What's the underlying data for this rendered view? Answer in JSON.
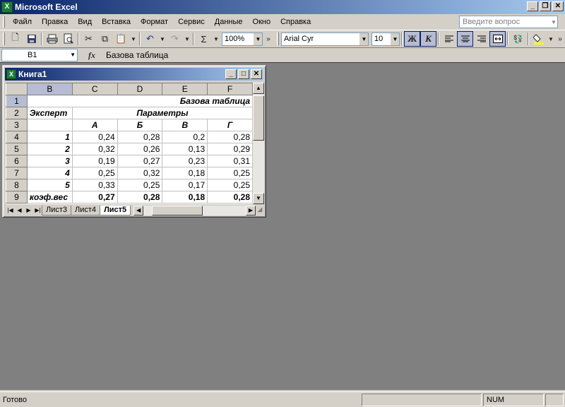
{
  "app": {
    "title": "Microsoft Excel"
  },
  "menu": {
    "items": [
      "Файл",
      "Правка",
      "Вид",
      "Вставка",
      "Формат",
      "Сервис",
      "Данные",
      "Окно",
      "Справка"
    ],
    "help_placeholder": "Введите вопрос"
  },
  "toolbar": {
    "zoom": "100%",
    "font": "Arial Cyr",
    "font_size": "10",
    "bold_label": "Ж",
    "italic_label": "К",
    "sum_label": "Σ"
  },
  "formula_bar": {
    "name_box": "B1",
    "fx_label": "fx",
    "content": "Базова таблица"
  },
  "workbook": {
    "title": "Книга1",
    "column_headers": [
      "B",
      "C",
      "D",
      "E",
      "F"
    ],
    "row_headers": [
      "1",
      "2",
      "3",
      "4",
      "5",
      "6",
      "7",
      "8",
      "9"
    ],
    "cells": {
      "title": "Базова таблица",
      "expert": "Эксперт",
      "params": "Параметры",
      "param_names": [
        "А",
        "Б",
        "В",
        "Г"
      ],
      "rows": [
        {
          "label": "1",
          "values": [
            "0,24",
            "0,28",
            "0,2",
            "0,28"
          ]
        },
        {
          "label": "2",
          "values": [
            "0,32",
            "0,26",
            "0,13",
            "0,29"
          ]
        },
        {
          "label": "3",
          "values": [
            "0,19",
            "0,27",
            "0,23",
            "0,31"
          ]
        },
        {
          "label": "4",
          "values": [
            "0,25",
            "0,32",
            "0,18",
            "0,25"
          ]
        },
        {
          "label": "5",
          "values": [
            "0,33",
            "0,25",
            "0,17",
            "0,25"
          ]
        }
      ],
      "coef_label": "коэф.вес",
      "coef_values": [
        "0,27",
        "0,28",
        "0,18",
        "0,28"
      ]
    },
    "sheet_tabs": [
      "Лист3",
      "Лист4",
      "Лист5"
    ],
    "active_tab": "Лист5"
  },
  "status": {
    "text": "Готово",
    "num": "NUM"
  }
}
